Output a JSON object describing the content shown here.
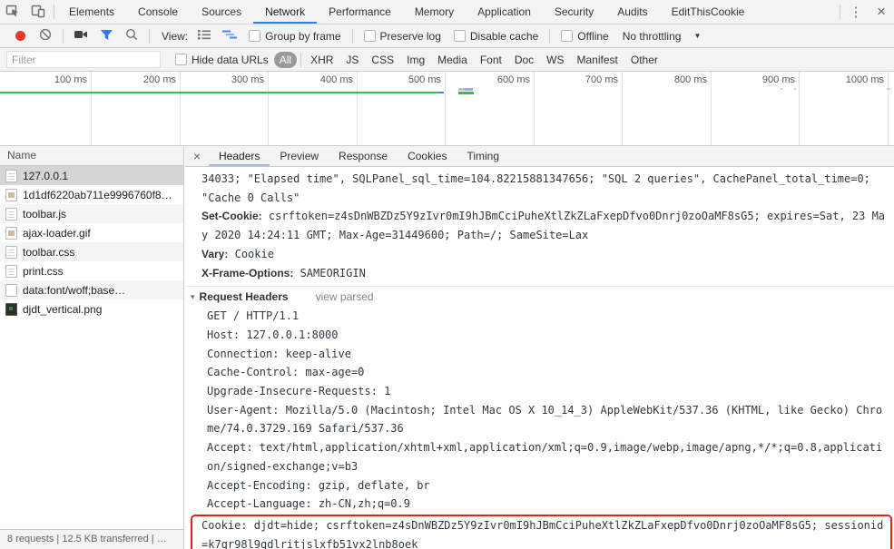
{
  "chrome": {
    "main_tabs": [
      "Elements",
      "Console",
      "Sources",
      "Network",
      "Performance",
      "Memory",
      "Application",
      "Security",
      "Audits",
      "EditThisCookie"
    ],
    "selected_main_tab": "Network",
    "toolbar": {
      "view_label": "View:",
      "group_by_frame": "Group by frame",
      "preserve_log": "Preserve log",
      "disable_cache": "Disable cache",
      "offline": "Offline",
      "throttling": "No throttling"
    },
    "filter": {
      "placeholder": "Filter",
      "hide_data_urls": "Hide data URLs",
      "types": [
        "All",
        "XHR",
        "JS",
        "CSS",
        "Img",
        "Media",
        "Font",
        "Doc",
        "WS",
        "Manifest",
        "Other"
      ],
      "selected_type": "All"
    },
    "ruler_labels": [
      "100 ms",
      "200 ms",
      "300 ms",
      "400 ms",
      "500 ms",
      "600 ms",
      "700 ms",
      "800 ms",
      "900 ms",
      "1000 ms"
    ],
    "request_list": {
      "column_header": "Name",
      "selected_row": "127.0.0.1",
      "rows": [
        {
          "name": "127.0.0.1",
          "icon": "document-icon"
        },
        {
          "name": "1d1df6220ab711e9996760f8…",
          "icon": "image-icon"
        },
        {
          "name": "toolbar.js",
          "icon": "script-icon"
        },
        {
          "name": "ajax-loader.gif",
          "icon": "image-icon"
        },
        {
          "name": "toolbar.css",
          "icon": "stylesheet-icon"
        },
        {
          "name": "print.css",
          "icon": "stylesheet-icon"
        },
        {
          "name": "data:font/woff;base…",
          "icon": "font-icon"
        },
        {
          "name": "djdt_vertical.png",
          "icon": "image-dark-icon"
        }
      ]
    },
    "status_bar": "8 requests | 12.5 KB transferred | …",
    "details": {
      "tabs": [
        "Headers",
        "Preview",
        "Response",
        "Cookies",
        "Timing"
      ],
      "selected_tab": "Headers",
      "headers_pane": {
        "clipped_value_line": "34033; \"Elapsed time\", SQLPanel_sql_time=104.82215881347656; \"SQL 2 queries\", CachePanel_total_time=0; \"Cache 0 Calls\"",
        "response_headers": [
          {
            "name": "Set-Cookie:",
            "value": "csrftoken=z4sDnWBZDz5Y9zIvr0mI9hJBmCciPuheXtlZkZLaFxepDfvo0Dnrj0zoOaMF8sG5; expires=Sat, 23 May 2020 14:24:11 GMT; Max-Age=31449600; Path=/; SameSite=Lax"
          },
          {
            "name": "Vary:",
            "value": "Cookie"
          },
          {
            "name": "X-Frame-Options:",
            "value": "SAMEORIGIN"
          }
        ],
        "request_headers_title": "Request Headers",
        "view_parsed_label": "view parsed",
        "request_header_lines": [
          "GET / HTTP/1.1",
          "Host: 127.0.0.1:8000",
          "Connection: keep-alive",
          "Cache-Control: max-age=0",
          "Upgrade-Insecure-Requests: 1",
          "User-Agent: Mozilla/5.0 (Macintosh; Intel Mac OS X 10_14_3) AppleWebKit/537.36 (KHTML, like Gecko) Chrome/74.0.3729.169 Safari/537.36",
          "Accept: text/html,application/xhtml+xml,application/xml;q=0.9,image/webp,image/apng,*/*;q=0.8,application/signed-exchange;v=b3",
          "Accept-Encoding: gzip, deflate, br",
          "Accept-Language: zh-CN,zh;q=0.9"
        ],
        "highlighted_cookie_line": "Cookie: djdt=hide; csrftoken=z4sDnWBZDz5Y9zIvr0mI9hJBmCciPuheXtlZkZLaFxepDfvo0Dnrj0zoOaMF8sG5; sessionid=k7qr98l9gdlritjslxfb51vx2lnb8oek"
      }
    },
    "colors": {
      "accent_blue": "#2d7ff0",
      "record_red": "#e8372c",
      "highlight_red": "#e62117",
      "overview_green": "#3cba54",
      "chrome_background": "#f3f3f3"
    }
  }
}
